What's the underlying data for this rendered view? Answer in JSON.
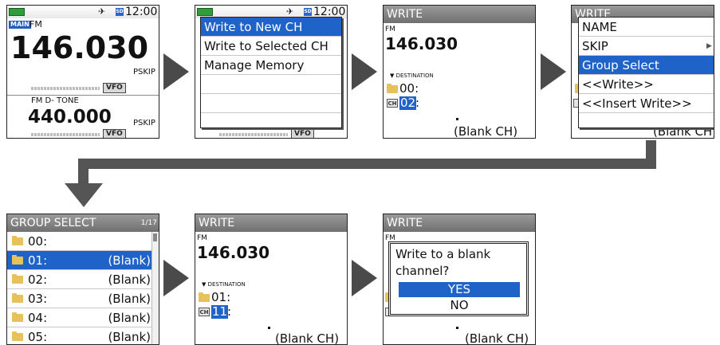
{
  "screen1": {
    "clock": "12:00",
    "main_badge": "MAIN",
    "mode_top": "FM",
    "freq_top": "146.030",
    "pskip_top": "PSKIP",
    "vfo_top": "VFO",
    "mode_bottom": "FM   D- TONE",
    "freq_bottom": "440.000",
    "pskip_bottom": "PSKIP",
    "vfo_bottom": "VFO"
  },
  "screen2": {
    "clock": "12:00",
    "vfo": "VFO",
    "menu": [
      "Write to New CH",
      "Write to Selected CH",
      "Manage Memory"
    ]
  },
  "screen3": {
    "title": "WRITE",
    "mode": "FM",
    "freq": "146.030",
    "destination_label": "▼ DESTINATION",
    "group": "00:",
    "ch_icon": "CH",
    "channel": "02",
    "colon": ":",
    "blank": "(Blank CH)"
  },
  "screen4": {
    "title_partial": "WRITE",
    "menu": [
      "NAME",
      "SKIP",
      "Group Select",
      "<<Write>>",
      "<<Insert Write>>"
    ],
    "blank_partial": "(Blank CH)"
  },
  "screen5": {
    "title": "GROUP SELECT",
    "page": "1/17",
    "rows": [
      {
        "label": "00:",
        "value": ""
      },
      {
        "label": "01:",
        "value": "(Blank)"
      },
      {
        "label": "02:",
        "value": "(Blank)"
      },
      {
        "label": "03:",
        "value": "(Blank)"
      },
      {
        "label": "04:",
        "value": "(Blank)"
      },
      {
        "label": "05:",
        "value": "(Blank)"
      }
    ]
  },
  "screen6": {
    "title": "WRITE",
    "mode": "FM",
    "freq": "146.030",
    "destination_label": "▼ DESTINATION",
    "group": "01:",
    "ch_icon": "CH",
    "channel": "11",
    "colon": ":",
    "blank": "(Blank CH)"
  },
  "screen7": {
    "title": "WRITE",
    "mode": "FM",
    "prompt_line1": "Write to a blank",
    "prompt_line2": "channel?",
    "yes": "YES",
    "no": "NO",
    "blank": "(Blank CH)"
  },
  "icons": {
    "arrow": "right-triangle-arrow",
    "down_arrow": "down-arrow"
  },
  "colors": {
    "highlight": "#1f63c8",
    "arrow": "#4a4a4a",
    "header": "#7f7f7f"
  }
}
